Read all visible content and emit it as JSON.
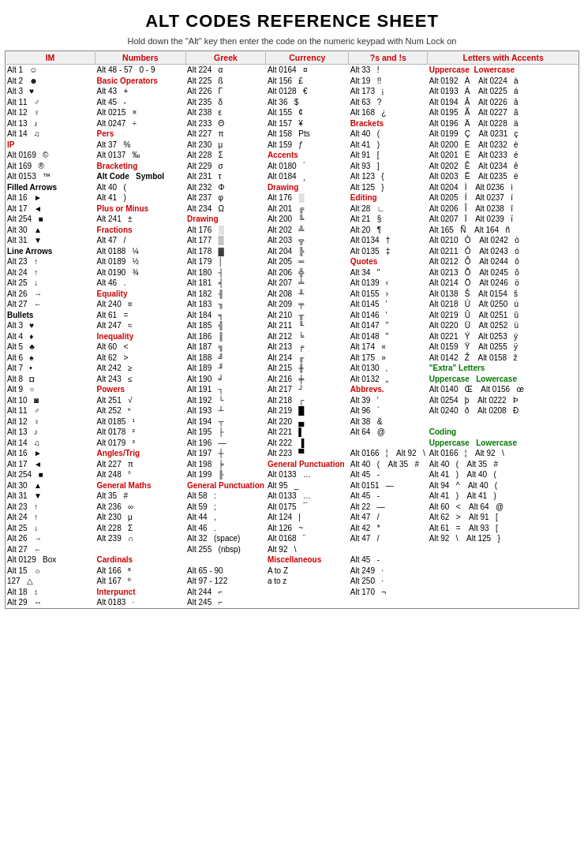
{
  "title": "ALT CODES REFERENCE SHEET",
  "subtitle": "Hold down the \"Alt\" key then enter the code on the numeric keypad with Num Lock on",
  "columns": {
    "col1_header": "IM",
    "col2_header": "Numbers",
    "col3_header": "Greek",
    "col4_header": "Currency",
    "col5_header": "?s and !s",
    "col6_header": "Letters with Accents"
  }
}
